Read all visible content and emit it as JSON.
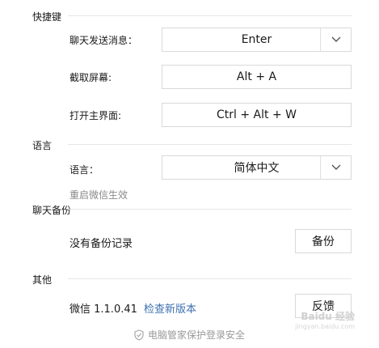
{
  "sections": {
    "shortcuts": "快捷键",
    "language": "语言",
    "backup": "聊天备份",
    "other": "其他"
  },
  "shortcuts": {
    "send_label": "聊天发送消息：",
    "send_value": "Enter",
    "screenshot_label": "截取屏幕:",
    "screenshot_value": "Alt + A",
    "open_main_label": "打开主界面:",
    "open_main_value": "Ctrl + Alt + W"
  },
  "language": {
    "label": "语言：",
    "value": "简体中文",
    "note": "重启微信生效"
  },
  "backup": {
    "status": "没有备份记录",
    "button": "备份"
  },
  "other": {
    "version": "微信 1.1.0.41",
    "check_update": "检查新版本",
    "feedback": "反馈"
  },
  "footer": {
    "text": "电脑管家保护登录安全"
  },
  "watermark": {
    "main": "Baidu 经验",
    "sub": "jingyan.baidu.com"
  },
  "colors": {
    "link": "#3b6fb0",
    "divider": "#e6e6e6",
    "muted": "#8a8a8a"
  }
}
